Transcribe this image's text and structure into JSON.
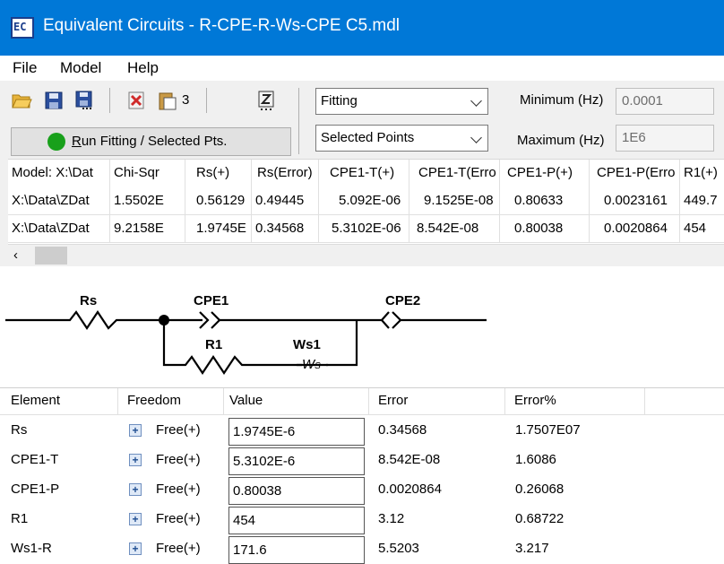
{
  "window": {
    "title": "Equivalent Circuits - R-CPE-R-Ws-CPE C5.mdl"
  },
  "menu": [
    "File",
    "Model",
    "Help"
  ],
  "toolbar": {
    "paste_count": "3",
    "mode_select": "Fitting",
    "points_select": "Selected Points",
    "min_label": "Minimum (Hz)",
    "min_value": "0.0001",
    "max_label": "Maximum (Hz)",
    "max_value": "1E6",
    "run_button": "Run Fitting / Selected Pts.",
    "run_underline": "R",
    "run_rest": "un Fitting / Selected Pts."
  },
  "results": {
    "columns": [
      "Model: X:\\Dat",
      "Chi-Sqr",
      "Rs(+)",
      "Rs(Error)",
      "CPE1-T(+)",
      "CPE1-T(Erro",
      "CPE1-P(+)",
      "CPE1-P(Erro",
      "R1(+)"
    ],
    "rows": [
      [
        "X:\\Data\\ZDat",
        "1.5502E",
        "0.56129",
        "0.49445",
        "5.092E-06",
        "9.1525E-08",
        "0.80633",
        "0.0023161",
        "449.7"
      ],
      [
        "X:\\Data\\ZDat",
        "9.2158E",
        "1.9745E",
        "0.34568",
        "5.3102E-06",
        "8.542E-08",
        "0.80038",
        "0.0020864",
        "454"
      ]
    ]
  },
  "circuit": {
    "labels": {
      "rs": "Rs",
      "cpe1": "CPE1",
      "cpe2": "CPE2",
      "r1": "R1",
      "ws1": "Ws1",
      "ws_symbol": "W",
      "ws_sub": "S"
    }
  },
  "params": {
    "columns": [
      "Element",
      "Freedom",
      "Value",
      "Error",
      "Error%"
    ],
    "rows": [
      {
        "element": "Rs",
        "freedom": "Free(+)",
        "value": "1.9745E-6",
        "error": "0.34568",
        "error_pct": "1.7507E07"
      },
      {
        "element": "CPE1-T",
        "freedom": "Free(+)",
        "value": "5.3102E-6",
        "error": "8.542E-08",
        "error_pct": "1.6086"
      },
      {
        "element": "CPE1-P",
        "freedom": "Free(+)",
        "value": "0.80038",
        "error": "0.0020864",
        "error_pct": "0.26068"
      },
      {
        "element": "R1",
        "freedom": "Free(+)",
        "value": "454",
        "error": "3.12",
        "error_pct": "0.68722"
      },
      {
        "element": "Ws1-R",
        "freedom": "Free(+)",
        "value": "171.6",
        "error": "5.5203",
        "error_pct": "3.217"
      }
    ]
  },
  "colors": {
    "title_bar": "#0078d7",
    "run_indicator": "#18a01b"
  }
}
